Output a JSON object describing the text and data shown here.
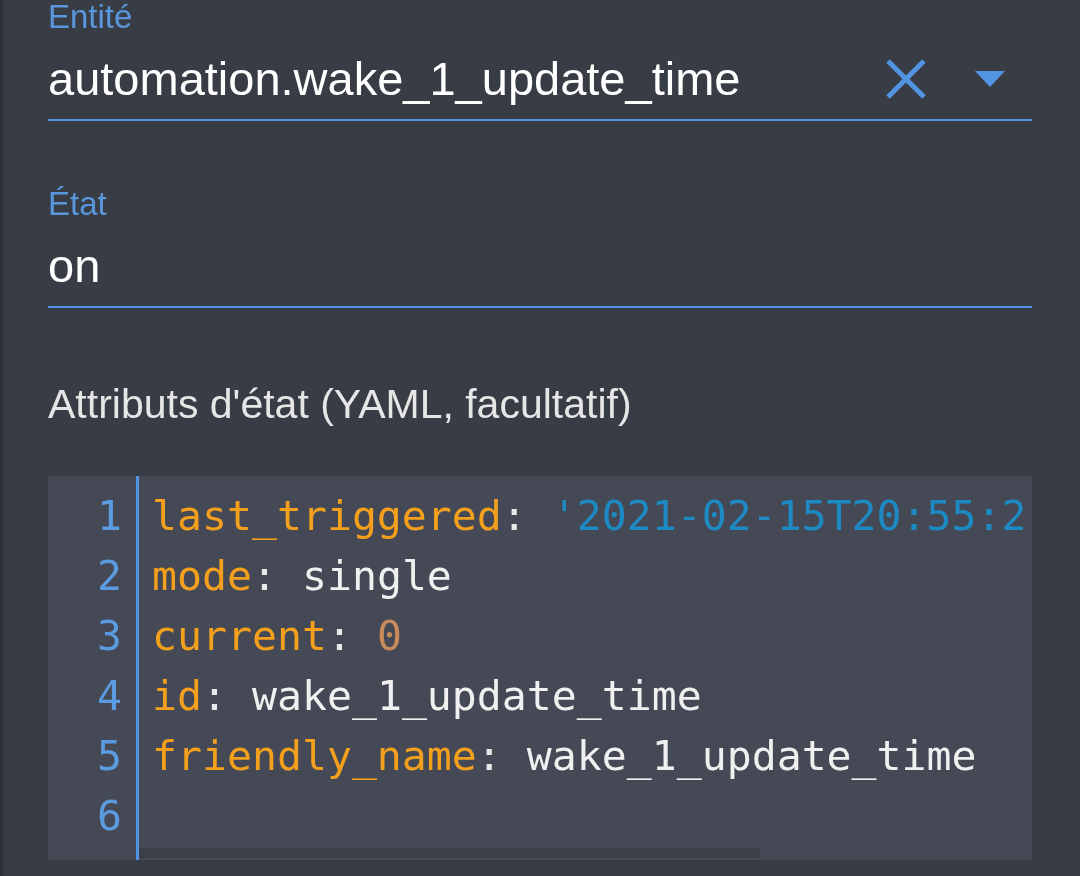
{
  "fields": [
    {
      "kind": "combobox",
      "label": "Entité",
      "value": "automation.wake_1_update_time"
    },
    {
      "kind": "text",
      "label": "État",
      "value": "on"
    }
  ],
  "attributes": {
    "label": "Attributs d'état (YAML, facultatif)",
    "editor": {
      "lines": [
        {
          "number": "1",
          "tokens": [
            {
              "kind": "key",
              "text": "last_triggered"
            },
            {
              "kind": "punct",
              "text": ": "
            },
            {
              "kind": "string",
              "text": "'2021-02-15T20:55:2"
            }
          ]
        },
        {
          "number": "2",
          "tokens": [
            {
              "kind": "key",
              "text": "mode"
            },
            {
              "kind": "punct",
              "text": ": "
            },
            {
              "kind": "plain",
              "text": "single"
            }
          ]
        },
        {
          "number": "3",
          "tokens": [
            {
              "kind": "key",
              "text": "current"
            },
            {
              "kind": "punct",
              "text": ": "
            },
            {
              "kind": "number",
              "text": "0"
            }
          ]
        },
        {
          "number": "4",
          "tokens": [
            {
              "kind": "key",
              "text": "id"
            },
            {
              "kind": "punct",
              "text": ": "
            },
            {
              "kind": "plain",
              "text": "wake_1_update_time"
            }
          ]
        },
        {
          "number": "5",
          "tokens": [
            {
              "kind": "key",
              "text": "friendly_name"
            },
            {
              "kind": "punct",
              "text": ": "
            },
            {
              "kind": "plain",
              "text": "wake_1_update_time"
            }
          ]
        },
        {
          "number": "6"
        }
      ]
    }
  }
}
